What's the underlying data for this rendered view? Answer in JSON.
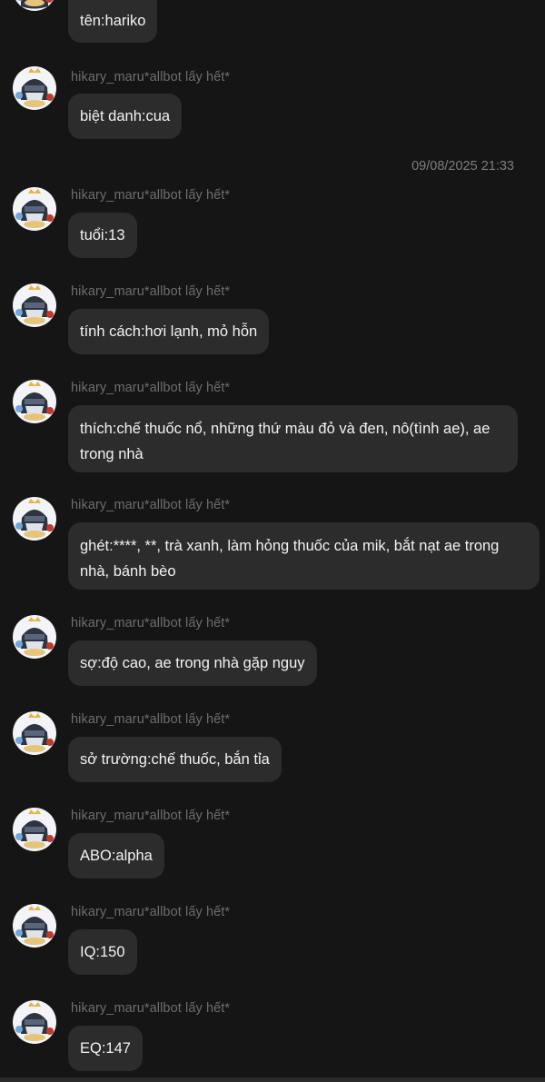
{
  "timestamp": "09/08/2025 21:33",
  "sender_name": "hikary_maru*allbot lấy hết*",
  "messages": [
    {
      "text": "tên:hariko"
    },
    {
      "text": "biệt danh:cua"
    },
    {
      "text": "tuổi:13"
    },
    {
      "text": "tính cách:hơi lạnh, mỏ hỗn"
    },
    {
      "text": "thích:chế thuốc nổ, những thứ màu đỏ và đen, nô(tình ae), ae trong nhà"
    },
    {
      "text": "ghét:****, **, trà xanh, làm hỏng thuốc của mik, bắt nạt ae trong nhà, bánh bèo"
    },
    {
      "text": "sợ:độ cao, ae trong nhà gặp nguy"
    },
    {
      "text": "sở trường:chế thuốc, bắn tỉa"
    },
    {
      "text": "ABO:alpha"
    },
    {
      "text": "IQ:150"
    },
    {
      "text": "EQ:147"
    }
  ],
  "colors": {
    "background": "#151515",
    "bubble": "#2c2c2c",
    "sender_name": "#6d6d6d",
    "timestamp": "#7d7d7d"
  }
}
